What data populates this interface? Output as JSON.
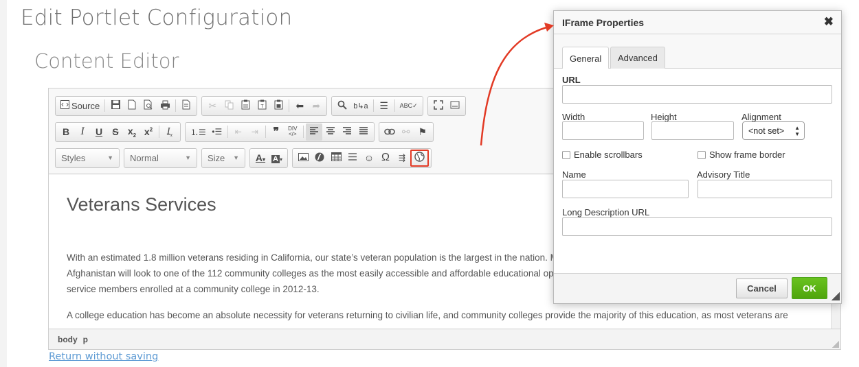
{
  "page": {
    "title": "Edit Portlet Configuration",
    "section_title": "Content Editor",
    "return_link": "Return without saving"
  },
  "toolbar": {
    "source_label": "Source",
    "styles_label": "Styles",
    "format_label": "Normal",
    "size_label": "Size",
    "row1_icons": [
      "source-icon",
      "save-icon",
      "new-page-icon",
      "preview-icon",
      "print-icon",
      "templates-icon",
      "cut-icon",
      "copy-icon",
      "paste-icon",
      "paste-text-icon",
      "paste-word-icon",
      "undo-icon",
      "redo-icon",
      "find-icon",
      "replace-icon",
      "select-all-icon",
      "spellcheck-icon",
      "maximize-icon",
      "show-blocks-icon"
    ],
    "row2_icons": [
      "bold-icon",
      "italic-icon",
      "underline-icon",
      "strike-icon",
      "subscript-icon",
      "superscript-icon",
      "remove-format-icon",
      "numbered-list-icon",
      "bulleted-list-icon",
      "outdent-icon",
      "indent-icon",
      "blockquote-icon",
      "div-icon",
      "align-left-icon",
      "align-center-icon",
      "align-right-icon",
      "justify-icon",
      "link-icon",
      "unlink-icon",
      "anchor-icon"
    ],
    "row3_icons": [
      "text-color-icon",
      "bg-color-icon",
      "image-icon",
      "flash-icon",
      "table-icon",
      "horizontal-rule-icon",
      "smiley-icon",
      "special-char-icon",
      "page-break-icon",
      "iframe-icon"
    ]
  },
  "content": {
    "heading": "Veterans Services",
    "paragraph1": [
      "With an estimated 1.8 million veterans residing in California, our state’s veteran population is the largest in the nation. M",
      "Afghanistan will look to one of the 112 community colleges as the most easily accessible and affordable educational opt",
      "service members enrolled at a community college in 2012-13."
    ],
    "paragraph2": [
      "A college education has become an absolute necessity for veterans returning to civilian life, and community colleges provide the majority of this education, as most veterans are"
    ]
  },
  "statusbar": {
    "path": [
      "body",
      "p"
    ]
  },
  "dialog": {
    "title": "IFrame Properties",
    "close_glyph": "✖",
    "tabs": [
      "General",
      "Advanced"
    ],
    "active_tab": "General",
    "fields": {
      "url_label": "URL",
      "url_value": "",
      "width_label": "Width",
      "width_value": "",
      "height_label": "Height",
      "height_value": "",
      "alignment_label": "Alignment",
      "alignment_value": "<not set>",
      "scrollbars_label": "Enable scrollbars",
      "scrollbars_checked": false,
      "frameborder_label": "Show frame border",
      "frameborder_checked": false,
      "name_label": "Name",
      "name_value": "",
      "advisory_label": "Advisory Title",
      "advisory_value": "",
      "longdesc_label": "Long Description URL",
      "longdesc_value": ""
    },
    "buttons": {
      "cancel": "Cancel",
      "ok": "OK"
    }
  },
  "colors": {
    "annotation_red": "#e23a25",
    "ok_green": "#5cb615",
    "link_blue": "#5e9bd4"
  }
}
